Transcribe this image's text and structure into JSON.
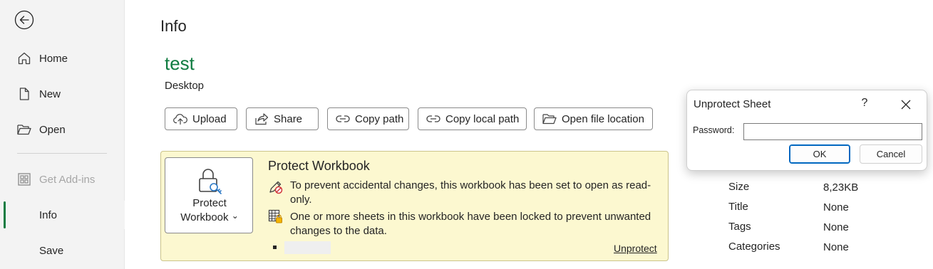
{
  "sidebar": {
    "back_icon": "back-arrow-icon",
    "items": [
      {
        "label": "Home",
        "icon": "home-icon"
      },
      {
        "label": "New",
        "icon": "new-document-icon"
      },
      {
        "label": "Open",
        "icon": "open-folder-icon"
      },
      {
        "label": "Get Add-ins",
        "icon": "add-ins-grid-icon",
        "disabled": true
      },
      {
        "label": "Info",
        "active": true
      },
      {
        "label": "Save"
      }
    ],
    "accent": "#107c41"
  },
  "main": {
    "title": "Info",
    "file_name": "test",
    "file_location": "Desktop",
    "actions": [
      {
        "label": "Upload",
        "icon": "upload-cloud-icon"
      },
      {
        "label": "Share",
        "icon": "share-icon"
      },
      {
        "label": "Copy path",
        "icon": "link-icon"
      },
      {
        "label": "Copy local path",
        "icon": "link-icon"
      },
      {
        "label": "Open file location",
        "icon": "folder-icon"
      }
    ]
  },
  "protect": {
    "tile_label_line1": "Protect",
    "tile_label_line2": "Workbook",
    "tile_chevron": "⌄",
    "heading": "Protect Workbook",
    "line1a": "To prevent accidental changes, this workbook has been set to open as read-",
    "line1b": "only.",
    "line2a": "One or more sheets in this workbook have been locked to prevent unwanted",
    "line2b": "changes to the data.",
    "unprotect_link": "Unprotect",
    "panel_color": "#fcf8d0"
  },
  "properties": [
    {
      "name": "Size",
      "value": "8,23KB"
    },
    {
      "name": "Title",
      "value": "None"
    },
    {
      "name": "Tags",
      "value": "None"
    },
    {
      "name": "Categories",
      "value": "None"
    }
  ],
  "dialog": {
    "title": "Unprotect Sheet",
    "help": "?",
    "password_label": "Password:",
    "password_value": "",
    "ok_label": "OK",
    "cancel_label": "Cancel"
  }
}
